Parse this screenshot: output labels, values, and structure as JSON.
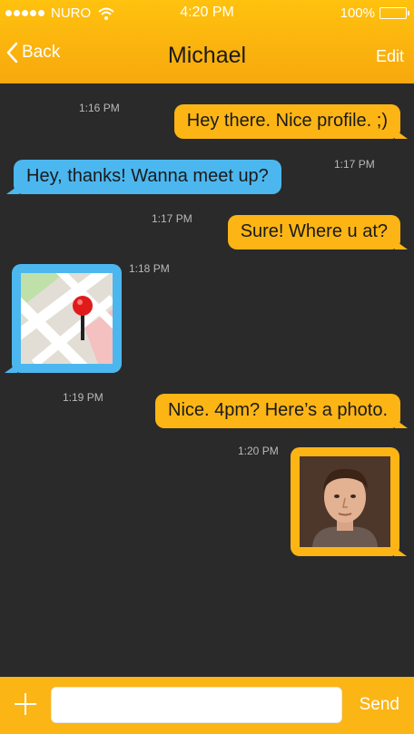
{
  "status_bar": {
    "carrier": "NURO",
    "time": "4:20 PM",
    "battery": "100%",
    "signal_icon": "signal-dots-icon",
    "wifi_icon": "wifi-icon",
    "battery_icon": "battery-icon"
  },
  "nav": {
    "back_label": "Back",
    "title": "Michael",
    "edit_label": "Edit"
  },
  "messages": [
    {
      "time": "1:16 PM",
      "text": "Hey there. Nice profile. ;)",
      "sender": "me"
    },
    {
      "time": "1:17 PM",
      "text": "Hey, thanks! Wanna meet up?",
      "sender": "them"
    },
    {
      "time": "1:17 PM",
      "text": "Sure! Where u at?",
      "sender": "me"
    },
    {
      "time": "1:18 PM",
      "type": "location",
      "sender": "them"
    },
    {
      "time": "1:19 PM",
      "text": "Nice. 4pm? Here’s a photo.",
      "sender": "me"
    },
    {
      "time": "1:20 PM",
      "type": "photo",
      "sender": "me"
    }
  ],
  "composer": {
    "placeholder": "",
    "send_label": "Send"
  },
  "colors": {
    "accent_yellow": "#fcb515",
    "incoming_blue": "#4cb7ef",
    "background": "#2a2a2a"
  }
}
